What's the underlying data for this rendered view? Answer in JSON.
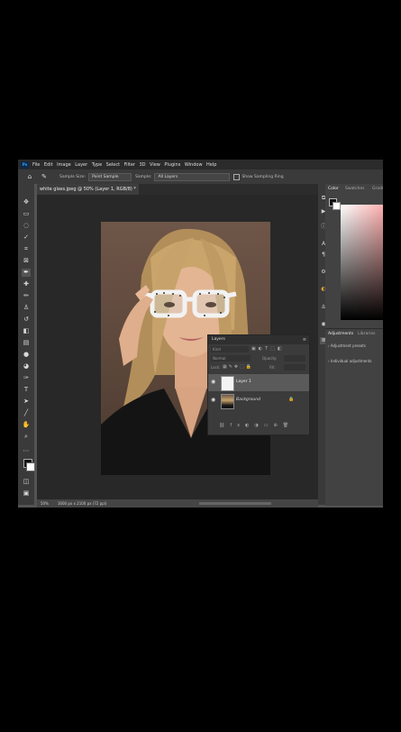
{
  "menu": {
    "app_icon": "Ps",
    "items": [
      "File",
      "Edit",
      "Image",
      "Layer",
      "Type",
      "Select",
      "Filter",
      "3D",
      "View",
      "Plugins",
      "Window",
      "Help"
    ]
  },
  "options": {
    "sample_size_label": "Sample Size:",
    "sample_size_value": "Point Sample",
    "sample_label": "Sample:",
    "sample_value": "All Layers",
    "show_ring_label": "Show Sampling Ring"
  },
  "document": {
    "tab_title": "white glass.jpeg @ 50% (Layer 1, RGB/8) *",
    "zoom": "50%",
    "status_info": "1600 px x 2100 px (72 ppi)"
  },
  "right_panels": {
    "color_tab": "Color",
    "swatches_tab": "Swatches",
    "gradients_tab": "Gradi",
    "adjustments_tab": "Adjustments",
    "libraries_tab": "Libraries",
    "adjustment_presets": "Adjustment presets",
    "individual_adjustments": "Individual adjustments"
  },
  "layers_panel": {
    "title": "Layers",
    "kind_filter": "Kind",
    "blend_mode": "Normal",
    "opacity_label": "Opacity:",
    "lock_label": "Lock:",
    "fill_label": "Fill:",
    "layers": [
      {
        "name": "Layer 1",
        "selected": true
      },
      {
        "name": "Background",
        "selected": false,
        "locked": true
      }
    ]
  },
  "colors": {
    "menubar_bg": "#2b2b2b",
    "workspace_bg": "#535353",
    "panel_bg": "#3b3b3b",
    "selected_layer": "#5a5a5a"
  }
}
